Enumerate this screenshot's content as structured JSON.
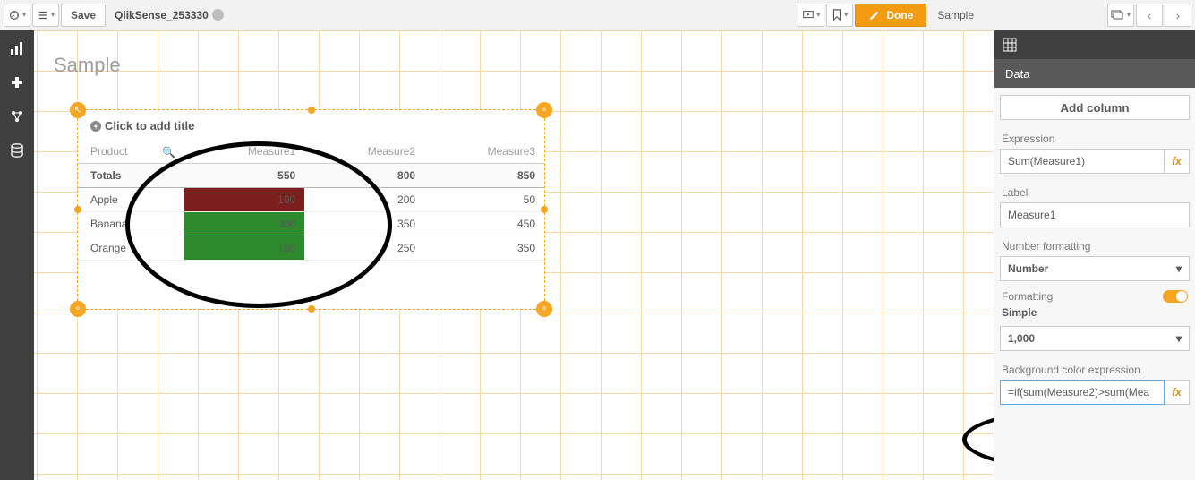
{
  "toolbar": {
    "save": "Save",
    "app_name": "QlikSense_253330",
    "done": "Done",
    "sheet_name": "Sample"
  },
  "canvas": {
    "sheet_title": "Sample",
    "viz_title": "Click to add title"
  },
  "table": {
    "headers": [
      "Product",
      "Measure1",
      "Measure2",
      "Measure3"
    ],
    "totals_label": "Totals",
    "totals": [
      "550",
      "800",
      "850"
    ],
    "rows": [
      {
        "product": "Apple",
        "m1": "100",
        "m2": "200",
        "m3": "50",
        "m1_color": "red"
      },
      {
        "product": "Banana",
        "m1": "300",
        "m2": "350",
        "m3": "450",
        "m1_color": "green"
      },
      {
        "product": "Orange",
        "m1": "150",
        "m2": "250",
        "m3": "350",
        "m1_color": "green"
      }
    ]
  },
  "props": {
    "panel_title": "Data",
    "add_column": "Add column",
    "expression_lbl": "Expression",
    "expression_val": "Sum(Measure1)",
    "label_lbl": "Label",
    "label_val": "Measure1",
    "numfmt_lbl": "Number formatting",
    "numfmt_val": "Number",
    "formatting_lbl": "Formatting",
    "formatting_mode": "Simple",
    "format_pattern": "1,000",
    "bgexpr_lbl": "Background color expression",
    "bgexpr_val": "=if(sum(Measure2)>sum(Mea"
  },
  "icons": {
    "caret": "▾",
    "chev_l": "‹",
    "chev_r": "›"
  }
}
